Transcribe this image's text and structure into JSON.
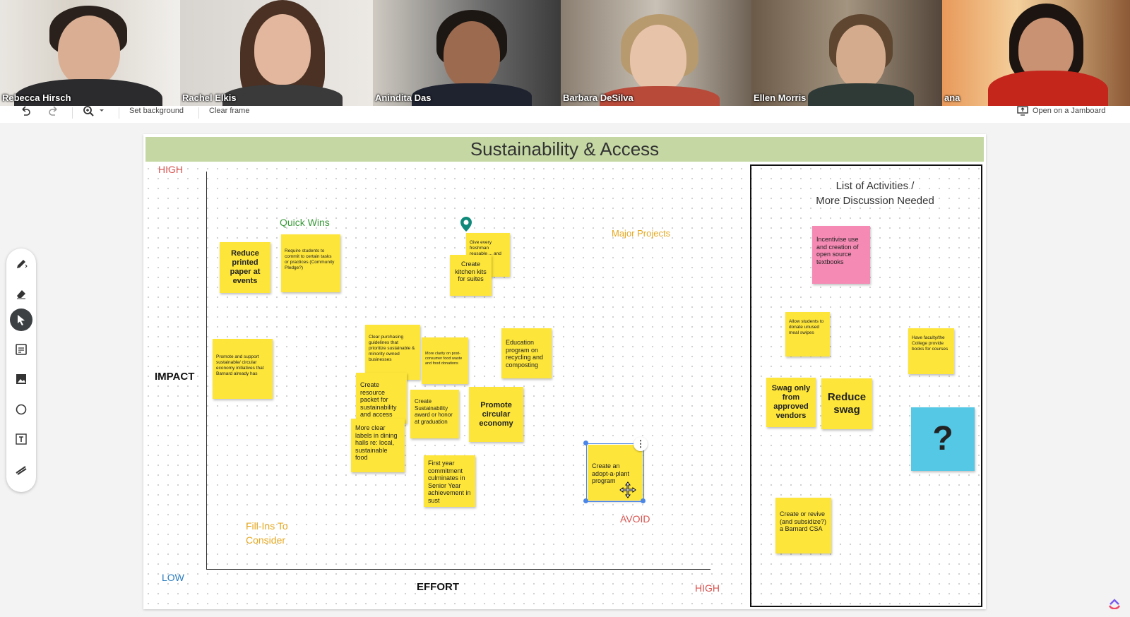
{
  "participants": [
    {
      "name": "Rebecca Hirsch"
    },
    {
      "name": "Rachel Elkis"
    },
    {
      "name": "Anindita Das"
    },
    {
      "name": "Barbara DeSilva"
    },
    {
      "name": "Ellen Morris"
    },
    {
      "name": "ana"
    }
  ],
  "toolbar": {
    "set_background": "Set background",
    "clear_frame": "Clear frame",
    "open_jamboard": "Open on a Jamboard"
  },
  "board": {
    "title": "Sustainability & Access",
    "high_top": "HIGH",
    "impact": "IMPACT",
    "low": "LOW",
    "effort": "EFFORT",
    "high_right": "HIGH",
    "quick_wins": "Quick Wins",
    "major_projects": "Major Projects",
    "fill_ins_1": "Fill-Ins To",
    "fill_ins_2": "Consider",
    "avoid": "AVOID",
    "list_title_1": "List  of Activities /",
    "list_title_2": "More Discussion Needed"
  },
  "notes": {
    "reduce_printed": "Reduce printed paper at events",
    "require_students": "Require students to commit to certain tasks or practices (Community Pledge?)",
    "give_freshman": "Give every freshman reusable ... and ware",
    "kitchen_kits": "Create kitchen kits for suites",
    "promote_support": "Promote and support sustainable/ circular economy initiatives that Barnard already has",
    "clear_purchasing": "Clear purchasing guidelines that prioritize sustainable & minority owned businesses",
    "more_clarity": "More clarity on post-consumer food waste and food donations",
    "education_program": "Education program on recycling and composting",
    "resource_packet": "Create resource packet for sustainability and access",
    "sustainability_award": "Create Sustainability award or honor at graduation",
    "promote_circular": "Promote circular economy",
    "clear_labels": "More clear labels in dining halls re: local, sustainable food",
    "first_year": "First year commitment culminates in Senior Year achievement in sust",
    "adopt_plant": "Create an adopt-a-plant program",
    "incentivise": "Incentivise use and creation of open source textbooks",
    "allow_students": "Allow students to donate unused meal swipes",
    "have_faculty": "Have faculty/the College provide books for courses",
    "swag_approved": "Swag only from approved vendors",
    "reduce_swag": "Reduce swag",
    "question": "?",
    "csa": "Create or revive (and subsidize?) a Barnard CSA"
  },
  "colors": {
    "sticky_yellow": "#fde53a",
    "sticky_pink": "#f58ab4",
    "sticky_blue": "#55c8e6",
    "title_green": "#c5d8a4",
    "label_red": "#d9534f",
    "label_blue": "#2a7cc0",
    "label_green": "#3b9a3b",
    "label_orange": "#e6a820"
  },
  "icons": [
    "undo-icon",
    "redo-icon",
    "zoom-icon",
    "pen-icon",
    "eraser-icon",
    "select-icon",
    "sticky-note-icon",
    "image-icon",
    "circle-icon",
    "text-box-icon",
    "laser-icon",
    "location-pin-icon",
    "present-icon"
  ]
}
